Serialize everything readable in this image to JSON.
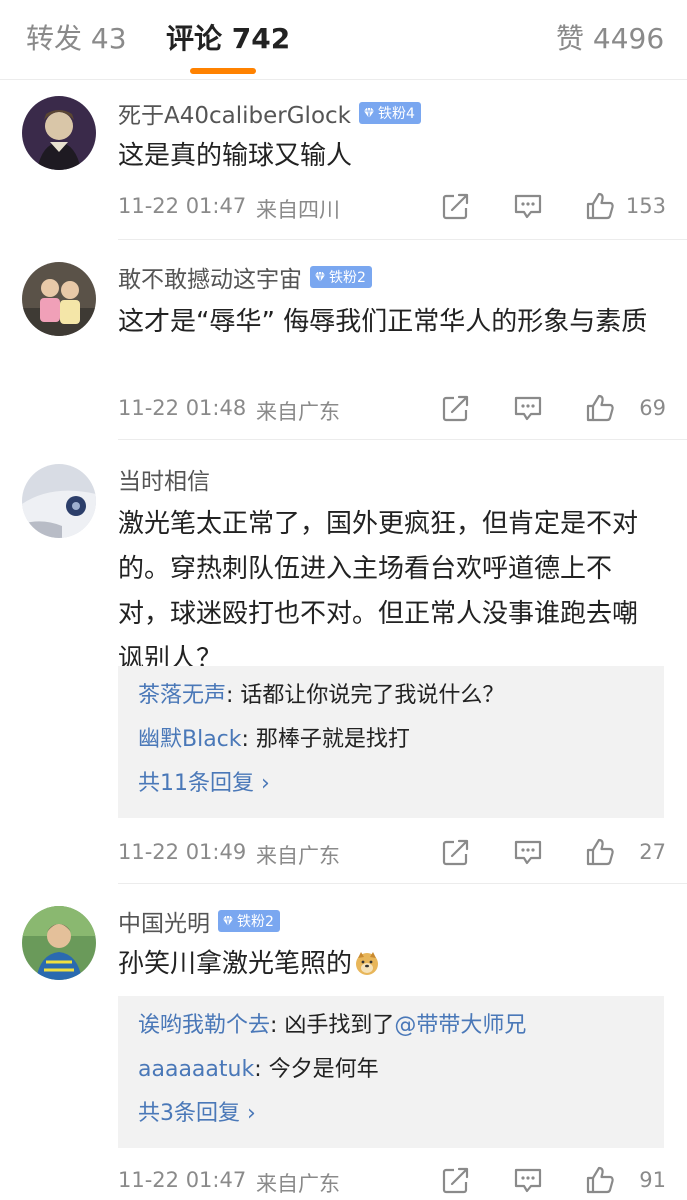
{
  "tabs": {
    "repost": "转发 43",
    "comments": "评论 742",
    "likes": "赞 4496",
    "accent_color": "#ff8200"
  },
  "comments": [
    {
      "username": "死于A40caliberGlock",
      "badge": "铁粉4",
      "text": "这是真的输球又输人",
      "time": "11-22 01:47",
      "location": "来自四川",
      "likes": "153"
    },
    {
      "username": "敢不敢撼动这宇宙",
      "badge": "铁粉2",
      "text": "这才是“辱华” 侮辱我们正常华人的形象与素质",
      "time": "11-22 01:48",
      "location": "来自广东",
      "likes": "69"
    },
    {
      "username": "当时相信",
      "text": "激光笔太正常了，国外更疯狂，但肯定是不对的。穿热刺队伍进入主场看台欢呼道德上不对，球迷殴打也不对。但正常人没事谁跑去嘲讽别人？",
      "time": "11-22 01:49",
      "location": "来自广东",
      "likes": "27",
      "replies": [
        {
          "user": "茶落无声",
          "text": ": 话都让你说完了我说什么？"
        },
        {
          "user": "幽默Black",
          "text": ": 那棒子就是找打"
        }
      ],
      "more_replies": "共11条回复 ›"
    },
    {
      "username": "中国光明",
      "badge": "铁粉2",
      "text": "孙笑川拿激光笔照的",
      "time": "11-22 01:47",
      "location": "来自广东",
      "likes": "91",
      "replies": [
        {
          "user": "诶哟我勒个去",
          "text": ": 凶手找到了",
          "mention": "@带带大师兄"
        },
        {
          "user": "aaaaaatuk",
          "text": ": 今夕是何年"
        }
      ],
      "more_replies": "共3条回复 ›"
    }
  ],
  "icons": {
    "share": "share-icon",
    "comment": "comment-icon",
    "like": "thumbs-up-icon",
    "emoji": "doge-emoji-icon"
  }
}
